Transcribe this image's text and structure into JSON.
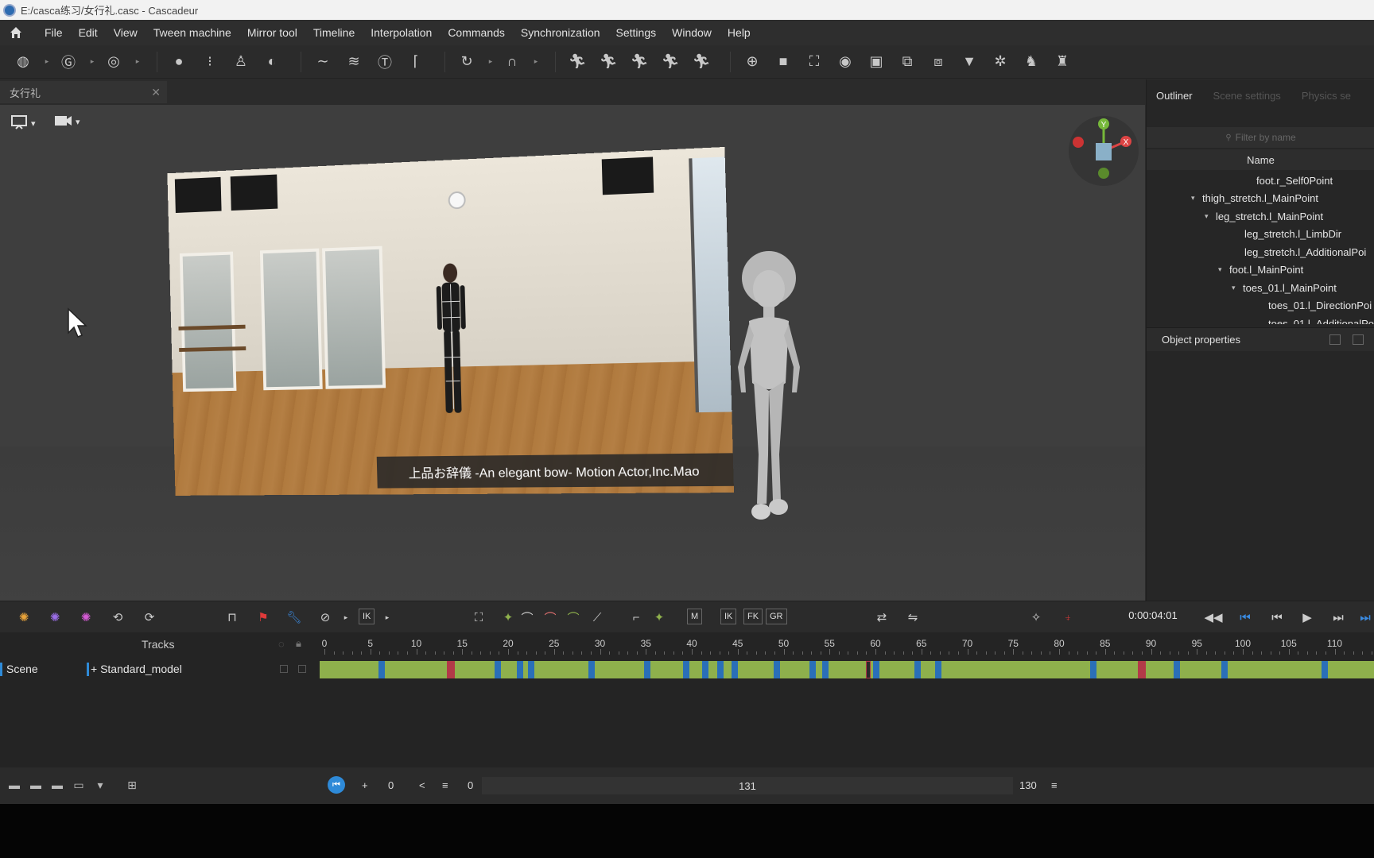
{
  "window": {
    "title": "E:/casca练习/女行礼.casc - Cascadeur"
  },
  "menu": [
    "File",
    "Edit",
    "View",
    "Tween machine",
    "Mirror tool",
    "Timeline",
    "Interpolation",
    "Commands",
    "Synchronization",
    "Settings",
    "Window",
    "Help"
  ],
  "document_tab": {
    "label": "女行礼",
    "close": "✕"
  },
  "viewport": {
    "video_caption": "上品お辞儀 -An elegant bow- Motion Actor,Inc.Mao",
    "gizmo": {
      "y": "Y",
      "x": "X"
    }
  },
  "right_panel": {
    "tabs": [
      "Outliner",
      "Scene settings",
      "Physics se"
    ],
    "filter_placeholder": "Filter by name",
    "column_header": "Name",
    "tree": [
      {
        "label": "foot.r_Self0Point",
        "arrow": ""
      },
      {
        "label": "thigh_stretch.l_MainPoint",
        "arrow": "▾"
      },
      {
        "label": "leg_stretch.l_MainPoint",
        "arrow": "▾"
      },
      {
        "label": "leg_stretch.l_LimbDir",
        "arrow": ""
      },
      {
        "label": "leg_stretch.l_AdditionalPoi",
        "arrow": ""
      },
      {
        "label": "foot.l_MainPoint",
        "arrow": "▾"
      },
      {
        "label": "toes_01.l_MainPoint",
        "arrow": "▾"
      },
      {
        "label": "toes_01.l_DirectionPoi",
        "arrow": ""
      },
      {
        "label": "toes_01.l_AdditionalPo",
        "arrow": ""
      }
    ],
    "object_properties": "Object properties"
  },
  "timeline": {
    "buttons": {
      "ik": "IK",
      "m": "M",
      "ik2": "IK",
      "fk": "FK",
      "gr": "GR"
    },
    "timecode": "0:00:04:01",
    "tracks_header": "Tracks",
    "scene": "Scene",
    "model": "+ Standard_model",
    "ruler": [
      "0",
      "5",
      "10",
      "15",
      "20",
      "25",
      "30",
      "35",
      "40",
      "45",
      "50",
      "55",
      "60",
      "65",
      "70",
      "75",
      "80",
      "85",
      "90",
      "95",
      "100",
      "105",
      "110"
    ]
  },
  "bottom": {
    "start": "0",
    "range_start": "0",
    "range_center": "131",
    "range_end": "130",
    "plus": "+",
    "chevron": "<",
    "menu": "≡"
  },
  "colors": {
    "track_green": "#8eb04c",
    "key_blue": "#2a6fb8",
    "key_red": "#b23a48",
    "accent_blue": "#2e8ad8"
  }
}
